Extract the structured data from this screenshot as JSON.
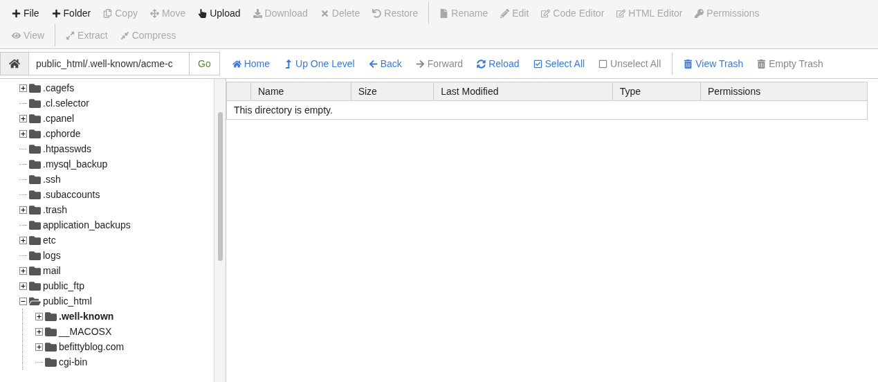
{
  "toolbar": {
    "rows": [
      [
        {
          "label": "File",
          "disabled": false
        },
        {
          "label": "Folder",
          "disabled": false
        },
        {
          "label": "Copy",
          "disabled": true
        },
        {
          "label": "Move",
          "disabled": true
        },
        {
          "label": "Upload",
          "disabled": false
        },
        {
          "label": "Download",
          "disabled": true
        },
        {
          "label": "Delete",
          "disabled": true
        },
        {
          "label": "Restore",
          "disabled": true
        },
        {
          "label": "Rename",
          "disabled": true
        },
        {
          "label": "Edit",
          "disabled": true
        },
        {
          "label": "Code Editor",
          "disabled": true
        },
        {
          "label": "HTML Editor",
          "disabled": true
        },
        {
          "label": "Permissions",
          "disabled": true
        }
      ],
      [
        {
          "label": "View",
          "disabled": true
        },
        {
          "label": "Extract",
          "disabled": true
        },
        {
          "label": "Compress",
          "disabled": true
        }
      ]
    ]
  },
  "path_bar": {
    "value": "public_html/.well-known/acme-c",
    "go": "Go"
  },
  "nav": [
    {
      "label": "Home",
      "disabled": false
    },
    {
      "label": "Up One Level",
      "disabled": false
    },
    {
      "label": "Back",
      "disabled": false
    },
    {
      "label": "Forward",
      "disabled": true
    },
    {
      "label": "Reload",
      "disabled": false
    },
    {
      "label": "Select All",
      "disabled": false
    },
    {
      "label": "Unselect All",
      "disabled": true
    },
    {
      "label": "View Trash",
      "disabled": false
    },
    {
      "label": "Empty Trash",
      "disabled": true
    }
  ],
  "tree": [
    {
      "name": ".cagefs",
      "expandable": true,
      "expanded": false,
      "selected": false
    },
    {
      "name": ".cl.selector",
      "expandable": false,
      "expanded": false,
      "selected": false
    },
    {
      "name": ".cpanel",
      "expandable": true,
      "expanded": false,
      "selected": false
    },
    {
      "name": ".cphorde",
      "expandable": true,
      "expanded": false,
      "selected": false
    },
    {
      "name": ".htpasswds",
      "expandable": false,
      "expanded": false,
      "selected": false
    },
    {
      "name": ".mysql_backup",
      "expandable": false,
      "expanded": false,
      "selected": false
    },
    {
      "name": ".ssh",
      "expandable": false,
      "expanded": false,
      "selected": false
    },
    {
      "name": ".subaccounts",
      "expandable": false,
      "expanded": false,
      "selected": false
    },
    {
      "name": ".trash",
      "expandable": true,
      "expanded": false,
      "selected": false
    },
    {
      "name": "application_backups",
      "expandable": false,
      "expanded": false,
      "selected": false
    },
    {
      "name": "etc",
      "expandable": true,
      "expanded": false,
      "selected": false
    },
    {
      "name": "logs",
      "expandable": false,
      "expanded": false,
      "selected": false
    },
    {
      "name": "mail",
      "expandable": true,
      "expanded": false,
      "selected": false
    },
    {
      "name": "public_ftp",
      "expandable": true,
      "expanded": false,
      "selected": false
    },
    {
      "name": "public_html",
      "expandable": true,
      "expanded": true,
      "selected": false,
      "children": [
        {
          "name": ".well-known",
          "expandable": true,
          "expanded": false,
          "selected": true
        },
        {
          "name": "__MACOSX",
          "expandable": true,
          "expanded": false,
          "selected": false
        },
        {
          "name": "befittyblog.com",
          "expandable": true,
          "expanded": false,
          "selected": false
        },
        {
          "name": "cgi-bin",
          "expandable": false,
          "expanded": false,
          "selected": false
        }
      ]
    }
  ],
  "table": {
    "columns": [
      "Name",
      "Size",
      "Last Modified",
      "Type",
      "Permissions"
    ],
    "empty_message": "This directory is empty."
  }
}
